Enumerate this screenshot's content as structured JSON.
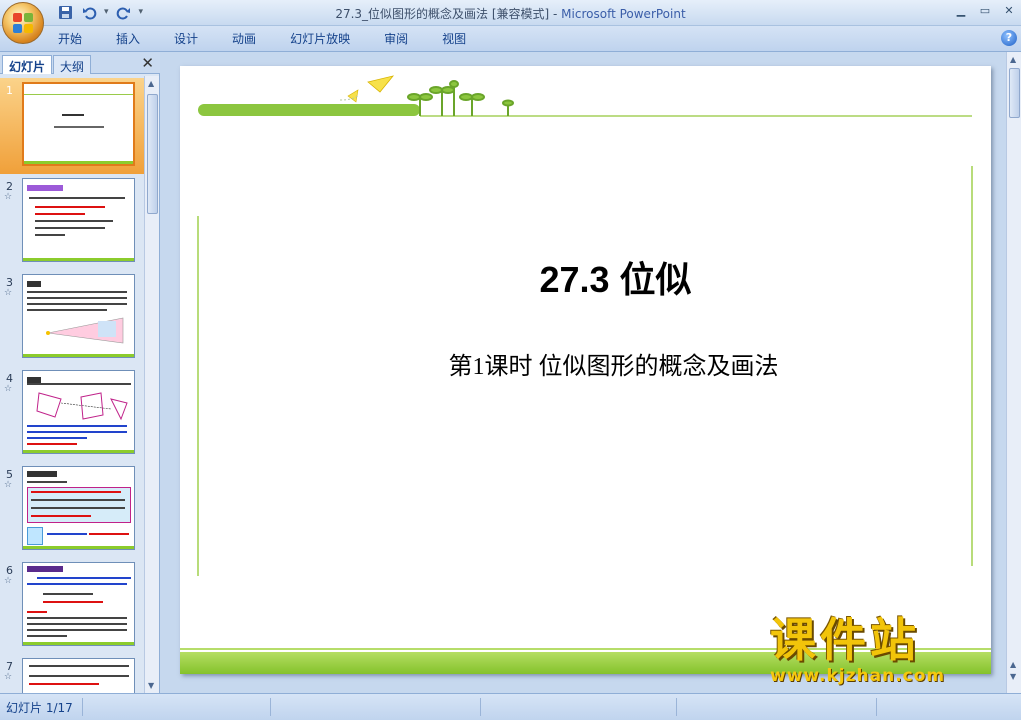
{
  "window": {
    "title_doc": "27.3_位似图形的概念及画法 [兼容模式] - ",
    "title_app": "Microsoft PowerPoint",
    "controls": [
      "minimize",
      "maximize",
      "close"
    ]
  },
  "quick_access": {
    "icons": [
      "save-icon",
      "undo-icon",
      "redo-icon",
      "customize-icon"
    ]
  },
  "ribbon": {
    "tabs": [
      "开始",
      "插入",
      "设计",
      "动画",
      "幻灯片放映",
      "审阅",
      "视图"
    ],
    "help": "?"
  },
  "left_pane": {
    "tabs": [
      "幻灯片",
      "大纲"
    ],
    "active_tab": "幻灯片",
    "close": "✕",
    "slides": [
      {
        "num": "1",
        "anim": ""
      },
      {
        "num": "2",
        "anim": "☆"
      },
      {
        "num": "3",
        "anim": "☆"
      },
      {
        "num": "4",
        "anim": "☆"
      },
      {
        "num": "5",
        "anim": "☆"
      },
      {
        "num": "6",
        "anim": "☆"
      },
      {
        "num": "7",
        "anim": "☆"
      }
    ]
  },
  "slide": {
    "title": "27.3 位似",
    "subtitle": "第1课时 位似图形的概念及画法"
  },
  "watermark": {
    "big": "课件站",
    "url": "www.kjzhan.com"
  },
  "status": {
    "slide_counter": "幻灯片 1/17"
  },
  "colors": {
    "accent_green": "#84c22b",
    "selected_orange": "#f0a03a",
    "ribbon_blue": "#15428b"
  }
}
